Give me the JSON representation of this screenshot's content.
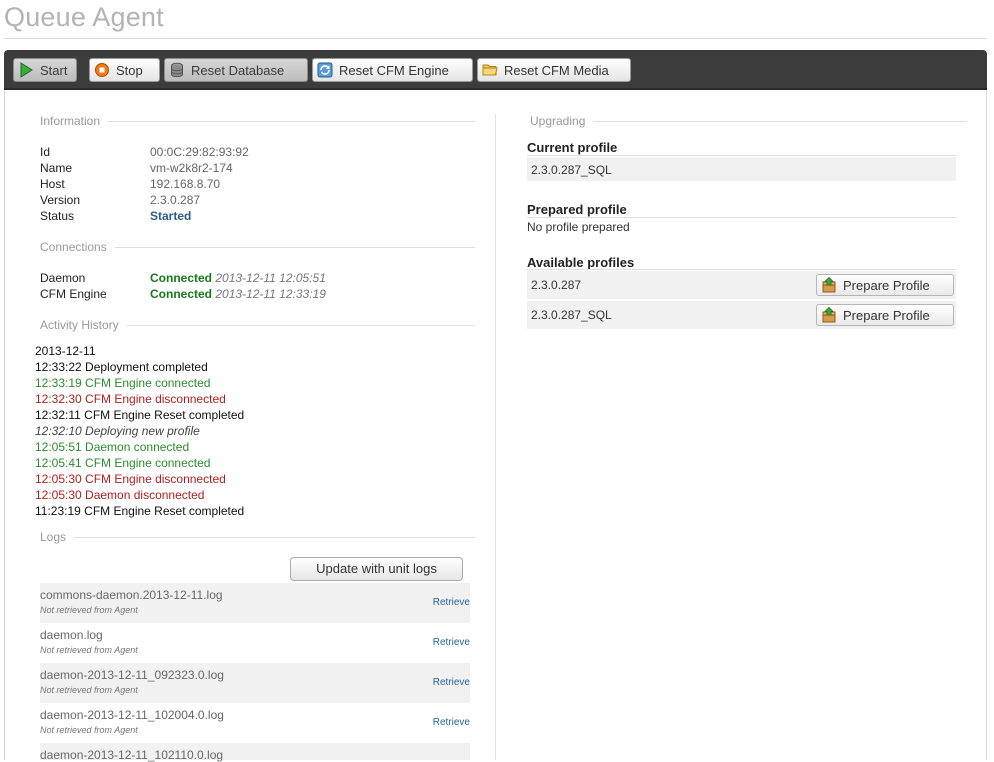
{
  "page": {
    "title": "Queue Agent"
  },
  "toolbar": {
    "start_label": "Start",
    "stop_label": "Stop",
    "reset_db_label": "Reset Database",
    "reset_engine_label": "Reset CFM Engine",
    "reset_media_label": "Reset CFM Media"
  },
  "information": {
    "heading": "Information",
    "rows": [
      {
        "label": "Id",
        "value": "00:0C:29:82:93:92"
      },
      {
        "label": "Name",
        "value": "vm-w2k8r2-174"
      },
      {
        "label": "Host",
        "value": "192.168.8.70"
      },
      {
        "label": "Version",
        "value": "2.3.0.287"
      },
      {
        "label": "Status",
        "value": "Started"
      }
    ]
  },
  "connections": {
    "heading": "Connections",
    "rows": [
      {
        "label": "Daemon",
        "status": "Connected",
        "time": "2013-12-11 12:05:51"
      },
      {
        "label": "CFM Engine",
        "status": "Connected",
        "time": "2013-12-11 12:33:19"
      }
    ]
  },
  "activity": {
    "heading": "Activity History",
    "date": "2013-12-11",
    "entries": [
      {
        "text": "12:33:22 Deployment completed",
        "kind": "black"
      },
      {
        "text": "12:33:19 CFM Engine connected",
        "kind": "green"
      },
      {
        "text": "12:32:30 CFM Engine disconnected",
        "kind": "red"
      },
      {
        "text": "12:32:11 CFM Engine Reset completed",
        "kind": "black"
      },
      {
        "text": "12:32:10 Deploying new profile",
        "kind": "italic"
      },
      {
        "text": "12:05:51 Daemon connected",
        "kind": "green"
      },
      {
        "text": "12:05:41 CFM Engine connected",
        "kind": "green"
      },
      {
        "text": "12:05:30 CFM Engine disconnected",
        "kind": "red"
      },
      {
        "text": "12:05:30 Daemon disconnected",
        "kind": "red"
      },
      {
        "text": "11:23:19 CFM Engine Reset completed",
        "kind": "black"
      }
    ]
  },
  "logs": {
    "heading": "Logs",
    "update_label": "Update with unit logs",
    "items": [
      {
        "name": "commons-daemon.2013-12-11.log",
        "status": "Not retrieved from Agent",
        "action": "Retrieve"
      },
      {
        "name": "daemon.log",
        "status": "Not retrieved from Agent",
        "action": "Retrieve"
      },
      {
        "name": "daemon-2013-12-11_092323.0.log",
        "status": "Not retrieved from Agent",
        "action": "Retrieve"
      },
      {
        "name": "daemon-2013-12-11_102004.0.log",
        "status": "Not retrieved from Agent",
        "action": "Retrieve"
      },
      {
        "name": "daemon-2013-12-11_102110.0.log",
        "status": "",
        "action": ""
      }
    ]
  },
  "upgrading": {
    "heading": "Upgrading",
    "current_heading": "Current profile",
    "current_value": "2.3.0.287_SQL",
    "prepared_heading": "Prepared profile",
    "prepared_value": "No profile prepared",
    "available_heading": "Available profiles",
    "available": [
      {
        "name": "2.3.0.287",
        "button": "Prepare Profile"
      },
      {
        "name": "2.3.0.287_SQL",
        "button": "Prepare Profile"
      }
    ]
  },
  "colors": {
    "toolbar_bg": "#3c3c3c",
    "connected": "#1a7a1a",
    "disconnected": "#b02020",
    "link": "#2a6496"
  }
}
